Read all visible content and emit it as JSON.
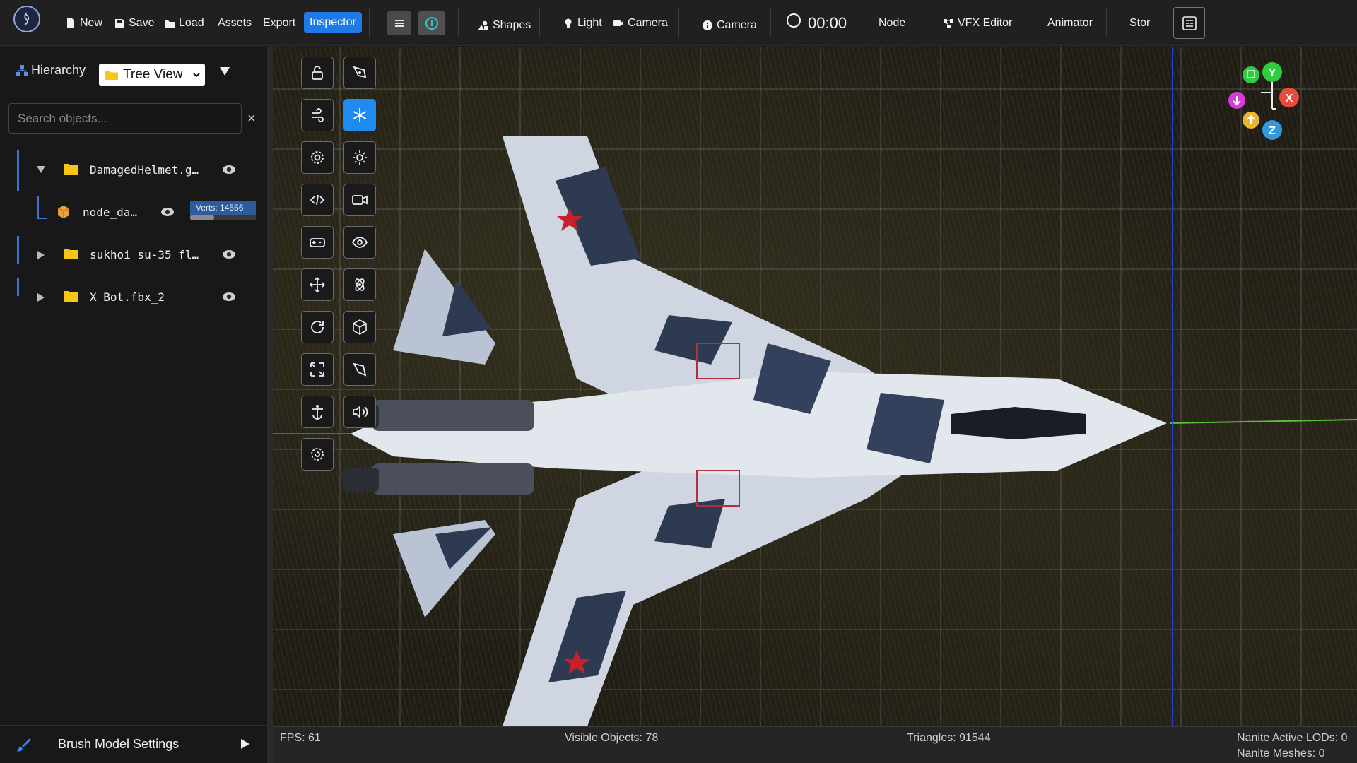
{
  "toolbar": {
    "new_label": "New",
    "save_label": "Save",
    "load_label": "Load",
    "assets_label": "Assets",
    "export_label": "Export",
    "inspector_label": "Inspector",
    "shapes_label": "Shapes",
    "light_label": "Light",
    "camera_label": "Camera",
    "camera_info_label": "Camera",
    "timer": "00:00",
    "node_label": "Node",
    "vfx_label": "VFX Editor",
    "animator_label": "Animator",
    "store_label": "Stor"
  },
  "hierarchy": {
    "title": "Hierarchy",
    "view_select": "Tree View",
    "search_placeholder": "Search objects...",
    "clear_symbol": "×",
    "items": [
      {
        "label": "DamagedHelmet.g…",
        "expanded": true
      },
      {
        "label": "node_da…",
        "child": true
      },
      {
        "label": "sukhoi_su-35_fl…",
        "expanded": false
      },
      {
        "label": "X Bot.fbx_2",
        "expanded": false
      }
    ],
    "verts_badge": "Verts: 14556"
  },
  "brush": {
    "label": "Brush Model Settings"
  },
  "gizmo": {
    "y": "Y",
    "x": "X",
    "z": "Z"
  },
  "status": {
    "fps": "FPS: 61",
    "visible_objects": "Visible Objects: 78",
    "triangles": "Triangles: 91544",
    "nanite_lods": "Nanite Active LODs: 0",
    "nanite_meshes": "Nanite Meshes: 0"
  },
  "colors": {
    "accent": "#1f7ae8",
    "tool_active": "#1f8af0",
    "tree_line": "#3f74d6",
    "folder": "#f5c518",
    "gizmo_y": "#2ecc40",
    "gizmo_x": "#e74c3c",
    "gizmo_z": "#3498db"
  },
  "icons": [
    "logo-icon",
    "file-icon",
    "save-icon",
    "folder-icon",
    "shapes-icon",
    "lightbulb-icon",
    "video-camera-icon",
    "info-icon",
    "hamburger-icon",
    "vfx-icon",
    "panel-icon",
    "lock-open-icon",
    "pen-tool-icon",
    "wind-icon",
    "snowflake-icon",
    "gear-icon",
    "sun-icon",
    "code-icon",
    "video-icon",
    "gamepad-icon",
    "eye-icon",
    "move-icon",
    "atom-icon",
    "rotate-icon",
    "cube-icon",
    "scale-icon",
    "vector-icon",
    "anchor-icon",
    "speaker-icon",
    "cog-refresh-icon",
    "brush-icon",
    "play-icon"
  ]
}
